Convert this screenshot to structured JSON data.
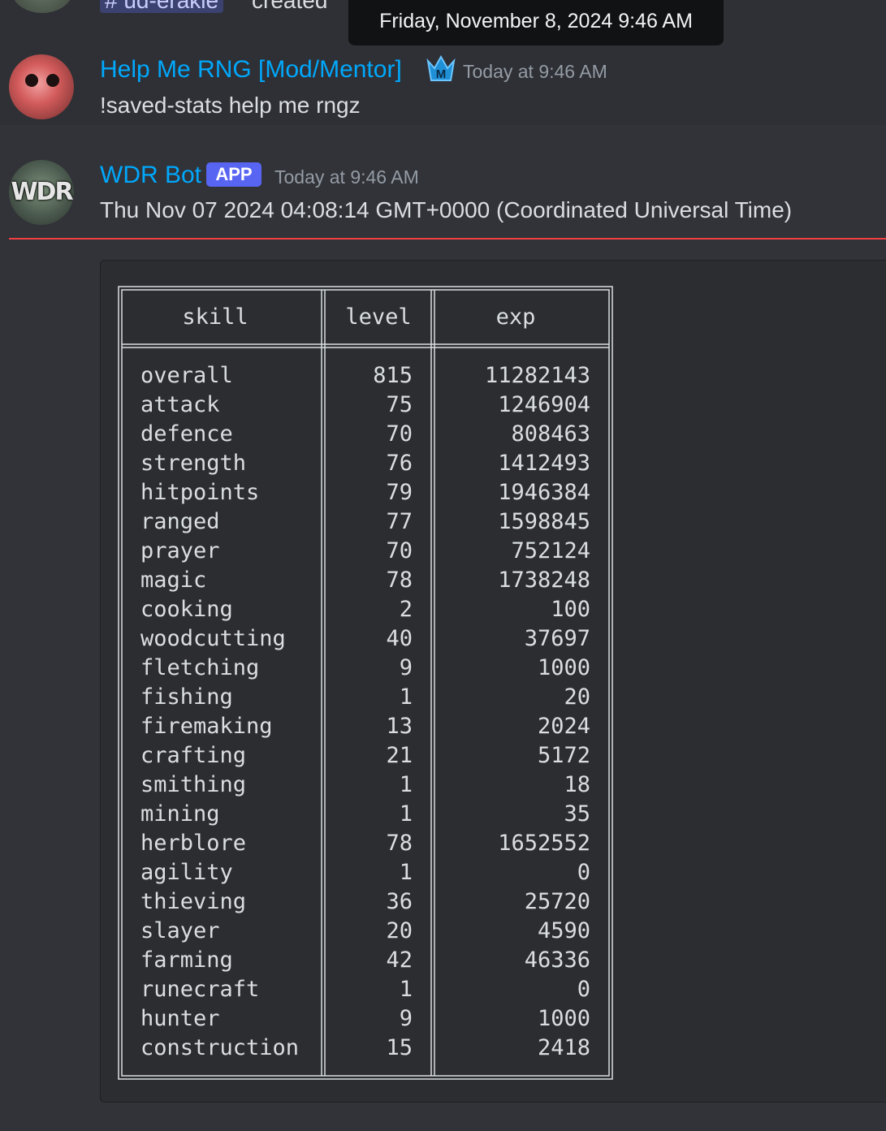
{
  "top_partial": {
    "channel_mention": "# ud-erakle",
    "created_text": "created"
  },
  "tooltip": {
    "text": "Friday, November 8, 2024 9:46 AM"
  },
  "message_1": {
    "author": "Help Me RNG [Mod/Mentor]",
    "badge_letter": "M",
    "timestamp": "Today at 9:46 AM",
    "content": "!saved-stats help me rngz"
  },
  "message_2": {
    "author": "WDR Bot",
    "app_badge": "APP",
    "avatar_text": "WDR",
    "timestamp": "Today at 9:46 AM",
    "content": "Thu Nov 07 2024 04:08:14 GMT+0000 (Coordinated Universal Time)"
  },
  "colors": {
    "background": "#313338",
    "highlight_background": "#2e3035",
    "username": "#00a8fc",
    "app_badge": "#5865f2",
    "new_messages_line": "#f23f43"
  },
  "table": {
    "headers": [
      "skill",
      "level",
      "exp"
    ],
    "rows": [
      [
        "overall",
        "815",
        "11282143"
      ],
      [
        "attack",
        "75",
        "1246904"
      ],
      [
        "defence",
        "70",
        "808463"
      ],
      [
        "strength",
        "76",
        "1412493"
      ],
      [
        "hitpoints",
        "79",
        "1946384"
      ],
      [
        "ranged",
        "77",
        "1598845"
      ],
      [
        "prayer",
        "70",
        "752124"
      ],
      [
        "magic",
        "78",
        "1738248"
      ],
      [
        "cooking",
        "2",
        "100"
      ],
      [
        "woodcutting",
        "40",
        "37697"
      ],
      [
        "fletching",
        "9",
        "1000"
      ],
      [
        "fishing",
        "1",
        "20"
      ],
      [
        "firemaking",
        "13",
        "2024"
      ],
      [
        "crafting",
        "21",
        "5172"
      ],
      [
        "smithing",
        "1",
        "18"
      ],
      [
        "mining",
        "1",
        "35"
      ],
      [
        "herblore",
        "78",
        "1652552"
      ],
      [
        "agility",
        "1",
        "0"
      ],
      [
        "thieving",
        "36",
        "25720"
      ],
      [
        "slayer",
        "20",
        "4590"
      ],
      [
        "farming",
        "42",
        "46336"
      ],
      [
        "runecraft",
        "1",
        "0"
      ],
      [
        "hunter",
        "9",
        "1000"
      ],
      [
        "construction",
        "15",
        "2418"
      ]
    ]
  }
}
